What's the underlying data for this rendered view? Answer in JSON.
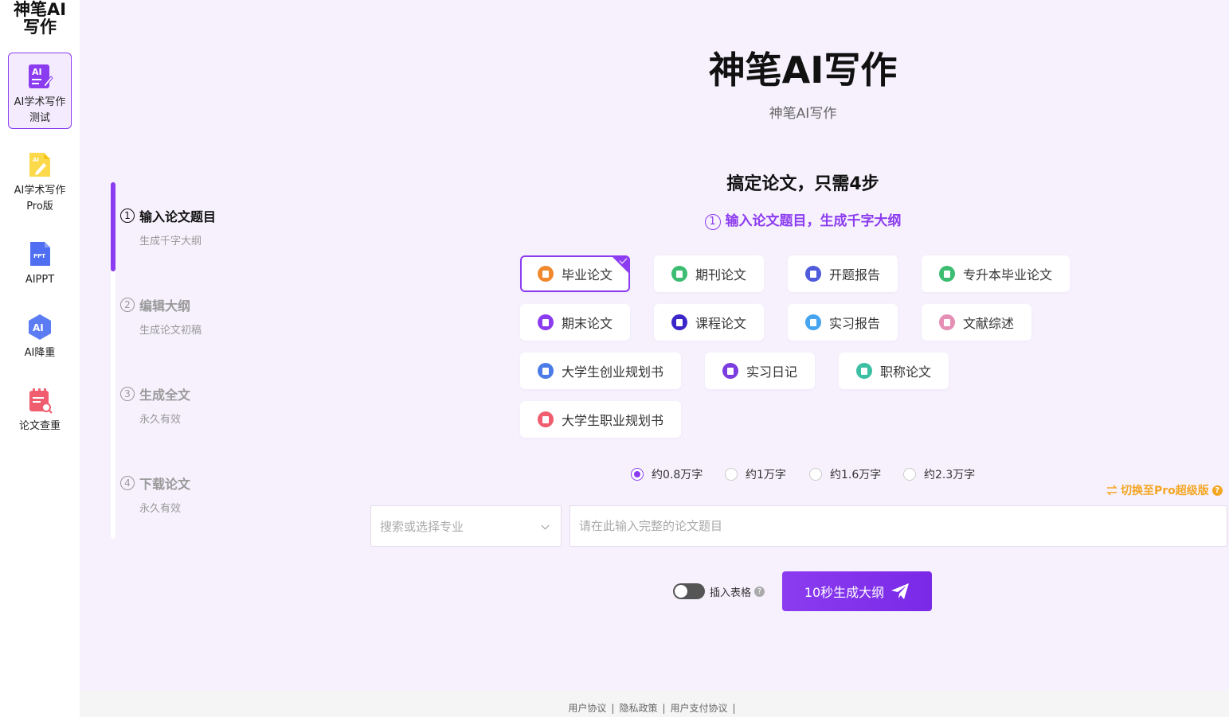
{
  "logo": {
    "line1": "神笔AI",
    "line2": "写作"
  },
  "sidebar": {
    "items": [
      {
        "label": "AI学术写作测试"
      },
      {
        "label": "AI学术写作Pro版"
      },
      {
        "label": "AIPPT"
      },
      {
        "label": "AI降重"
      },
      {
        "label": "论文查重"
      }
    ]
  },
  "steps": [
    {
      "num": "1",
      "title": "输入论文题目",
      "sub": "生成千字大纲"
    },
    {
      "num": "2",
      "title": "编辑大纲",
      "sub": "生成论文初稿"
    },
    {
      "num": "3",
      "title": "生成全文",
      "sub": "永久有效"
    },
    {
      "num": "4",
      "title": "下载论文",
      "sub": "永久有效"
    }
  ],
  "header": {
    "title": "神笔AI写作",
    "subtitle": "神笔AI写作",
    "steps_heading": "搞定论文，只需4步",
    "hint_num": "1",
    "hint": "输入论文题目，生成千字大纲"
  },
  "types": [
    {
      "label": "毕业论文",
      "color": "#f0892e"
    },
    {
      "label": "期刊论文",
      "color": "#3dbd72"
    },
    {
      "label": "开题报告",
      "color": "#4f5bdb"
    },
    {
      "label": "专升本毕业论文",
      "color": "#3dbd72"
    },
    {
      "label": "期末论文",
      "color": "#8c3cf0"
    },
    {
      "label": "课程论文",
      "color": "#3b27c9"
    },
    {
      "label": "实习报告",
      "color": "#47a5f0"
    },
    {
      "label": "文献综述",
      "color": "#e58fb5"
    },
    {
      "label": "大学生创业规划书",
      "color": "#4a7be8"
    },
    {
      "label": "实习日记",
      "color": "#7b3ce0"
    },
    {
      "label": "职称论文",
      "color": "#3cbfa3"
    },
    {
      "label": "大学生职业规划书",
      "color": "#ef5d6f"
    }
  ],
  "word_counts": [
    {
      "label": "约0.8万字"
    },
    {
      "label": "约1万字"
    },
    {
      "label": "约1.6万字"
    },
    {
      "label": "约2.3万字"
    }
  ],
  "pro_link": "切换至Pro超级版",
  "major_select": {
    "placeholder": "搜索或选择专业"
  },
  "title_input": {
    "placeholder": "请在此输入完整的论文题目"
  },
  "insert_table_label": "插入表格",
  "generate_button": "10秒生成大纲",
  "footer": {
    "links": [
      {
        "label": "用户协议"
      },
      {
        "label": "隐私政策"
      },
      {
        "label": "用户支付协议"
      }
    ]
  },
  "colors": {
    "accent": "#8c3cf0",
    "pro": "#f5a623",
    "background": "#f6f1fd"
  }
}
